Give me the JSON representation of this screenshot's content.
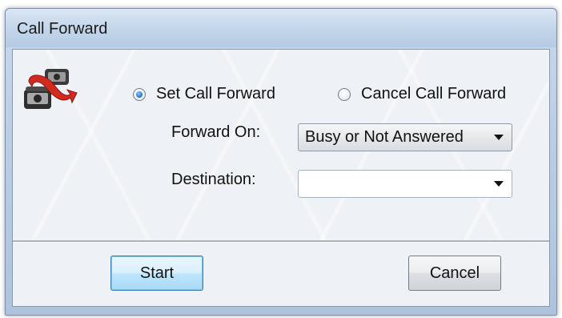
{
  "window": {
    "title": "Call Forward"
  },
  "mode": {
    "options": [
      {
        "label": "Set Call Forward",
        "checked": true
      },
      {
        "label": "Cancel Call Forward",
        "checked": false
      }
    ]
  },
  "form": {
    "forward_on": {
      "label": "Forward On:",
      "value": "Busy or Not Answered"
    },
    "destination": {
      "label": "Destination:",
      "value": ""
    }
  },
  "buttons": {
    "start": "Start",
    "cancel": "Cancel"
  },
  "icons": {
    "app": "call-forward-phones-icon",
    "dropdown": "chevron-down-icon"
  },
  "colors": {
    "radio_accent": "#1f6fc4",
    "forward_arrow": "#d32a1f"
  }
}
